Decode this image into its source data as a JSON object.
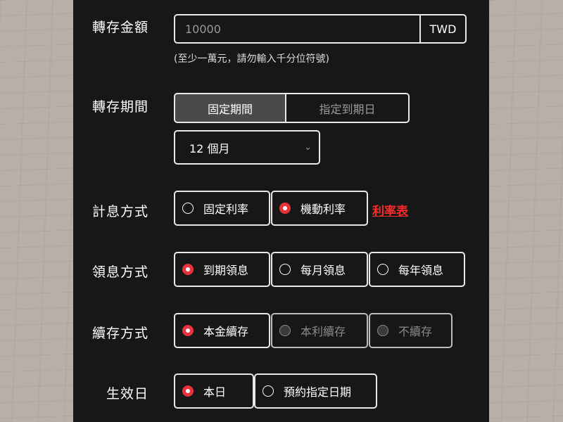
{
  "amount": {
    "label": "轉存金額",
    "value": "10000",
    "currency": "TWD",
    "hint": "(至少一萬元，請勿輸入千分位符號)"
  },
  "period": {
    "label": "轉存期間",
    "tabs": [
      "固定期間",
      "指定到期日"
    ],
    "selected_tab": "固定期間",
    "select_value": "12 個月"
  },
  "interest_type": {
    "label": "計息方式",
    "options": [
      "固定利率",
      "機動利率"
    ],
    "selected": "機動利率",
    "rate_link": "利率表"
  },
  "payout": {
    "label": "領息方式",
    "options": [
      "到期領息",
      "每月領息",
      "每年領息"
    ],
    "selected": "到期領息"
  },
  "renewal": {
    "label": "續存方式",
    "options": [
      "本金續存",
      "本利續存",
      "不續存"
    ],
    "selected": "本金續存"
  },
  "effective": {
    "label": "生效日",
    "options": [
      "本日",
      "預約指定日期"
    ],
    "selected": "本日"
  },
  "colors": {
    "accent": "#e8323c",
    "link": "#ff2b2b",
    "panel": "#171717"
  }
}
